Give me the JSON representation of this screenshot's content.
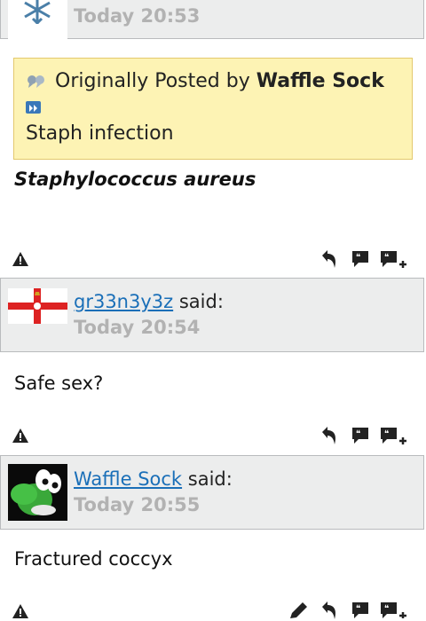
{
  "posts": [
    {
      "time": "Today 20:53",
      "quote": {
        "prefix": "Originally Posted by",
        "author": "Waffle Sock",
        "text": "Staph infection"
      },
      "message": "Staphylococcus aureus"
    },
    {
      "username": "gr33n3y3z",
      "said": "said:",
      "time": "Today 20:54",
      "message": "Safe sex?"
    },
    {
      "username": "Waffle Sock",
      "said": "said:",
      "time": "Today 20:55",
      "message": "Fractured coccyx"
    }
  ],
  "icons": {
    "report": "warning-triangle-icon",
    "reply": "reply-arrow-icon",
    "quote": "quote-bubble-icon",
    "multiquote": "multiquote-plus-icon",
    "edit": "pencil-icon"
  }
}
